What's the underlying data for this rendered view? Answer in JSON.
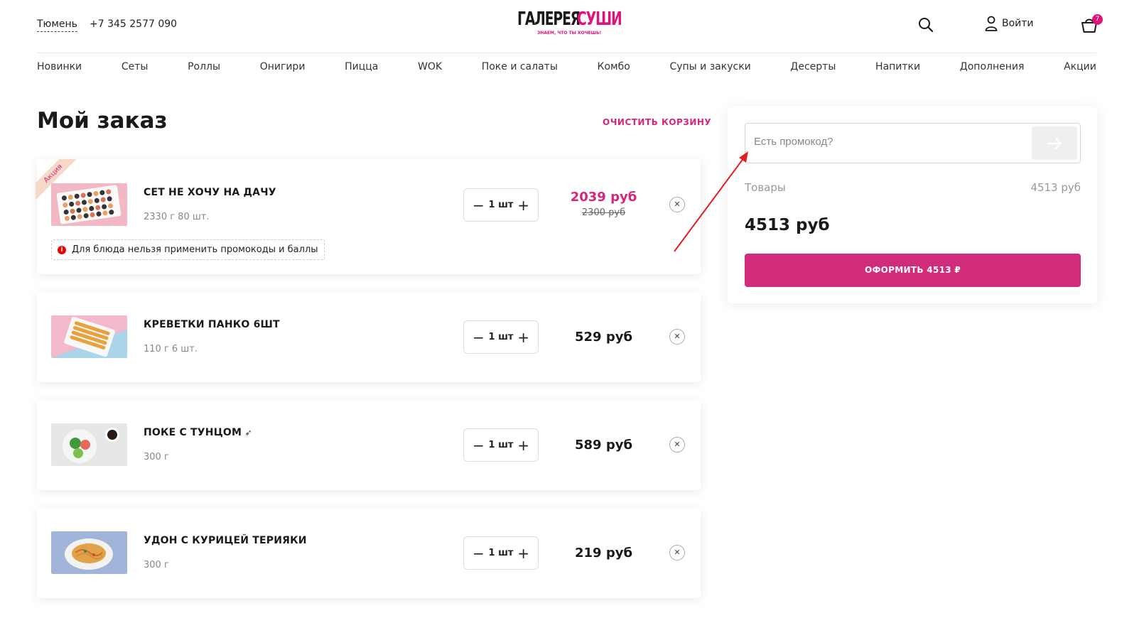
{
  "header": {
    "city": "Тюмень",
    "phone": "+7 345 2577 090",
    "logo_word1": "ГАЛЕРЕЯ",
    "logo_word2": "СУШИ",
    "logo_slogan": "ЗНАЕМ, ЧТО ТЫ ХОЧЕШЬ!",
    "login_label": "Войти",
    "cart_count": "7"
  },
  "nav": [
    "Новинки",
    "Сеты",
    "Роллы",
    "Онигири",
    "Пицца",
    "WOK",
    "Поке и салаты",
    "Комбо",
    "Супы и закуски",
    "Десерты",
    "Напитки",
    "Дополнения",
    "Акции"
  ],
  "page": {
    "title": "Мой заказ",
    "clear_cart": "ОЧИСТИТЬ КОРЗИНУ"
  },
  "items": [
    {
      "name": "СЕТ НЕ ХОЧУ НА ДАЧУ",
      "weight": "2330 г 80 шт.",
      "qty": "1 шт",
      "price": "2039 руб",
      "old_price": "2300 руб",
      "badge": "Акция",
      "warning": "Для блюда нельзя применить промокоды и баллы"
    },
    {
      "name": "КРЕВЕТКИ ПАНКО 6ШТ",
      "weight": "110 г 6 шт.",
      "qty": "1 шт",
      "price": "529 руб"
    },
    {
      "name": "ПОКЕ С ТУНЦОМ",
      "weight": "300 г",
      "qty": "1 шт",
      "price": "589 руб"
    },
    {
      "name": "УДОН С КУРИЦЕЙ ТЕРИЯКИ",
      "weight": "300 г",
      "qty": "1 шт",
      "price": "219 руб"
    }
  ],
  "summary": {
    "promo_placeholder": "Есть промокод?",
    "goods_label": "Товары",
    "goods_value": "4513 руб",
    "total": "4513 руб",
    "checkout_label": "ОФОРМИТЬ 4513 ₽"
  },
  "colors": {
    "accent": "#d12b7c",
    "annotation_arrow": "#e02020"
  }
}
